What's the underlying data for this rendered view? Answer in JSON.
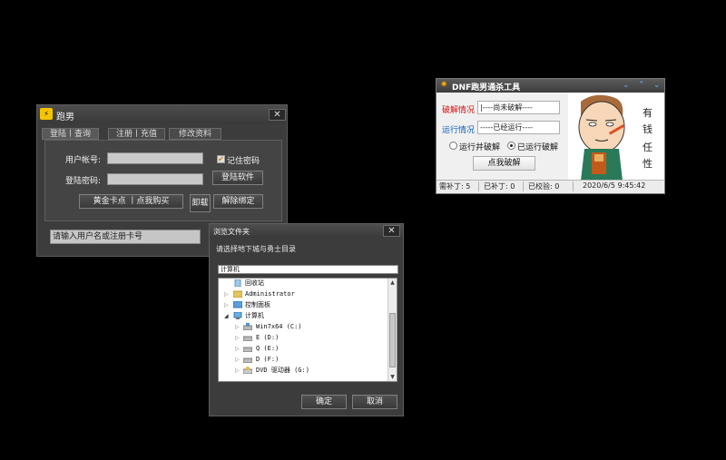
{
  "login_window": {
    "title": "跑男",
    "close": "✕",
    "tabs": [
      "登陆丨查询",
      "注册丨充值",
      "修改资料"
    ],
    "account_label": "用户帐号:",
    "password_label": "登陆密码:",
    "account_value": "",
    "password_value": "",
    "remember_label": "记住密码",
    "remember_checked": "✔",
    "login_button": "登陆软件",
    "buy_button": "黄金卡点 丨点我购买",
    "uninstall_button": "卸载",
    "unbind_button": "解除绑定",
    "status_text": "请输入用户名或注册卡号"
  },
  "tool_window": {
    "title": "DNF跑男通杀工具",
    "controls": [
      "⌄",
      "⌃",
      "⌄"
    ],
    "crack_label": "破解情况",
    "crack_value": "|----尚未破解----",
    "run_label": "运行情况",
    "run_value": "-----已经运行----",
    "radio_run_crack": "运行并破解",
    "radio_already": "已运行破解",
    "crack_button": "点我破解",
    "cartoon_text_1": "有",
    "cartoon_text_2": "钱",
    "cartoon_text_3": "任",
    "cartoon_text_4": "性",
    "status": {
      "need_patch": "需补丁: 5",
      "patched": "已补丁: 0",
      "verified": "已校验: 0",
      "datetime": "2020/6/5 9:45:42"
    },
    "colors": {
      "crack_label": "#d81010",
      "run_label": "#1060c0"
    }
  },
  "browse_dialog": {
    "title": "浏览文件夹",
    "close": "✕",
    "prompt": "请选择地下城与勇士目录",
    "path_value": "计算机",
    "tree": [
      {
        "label": "回收站",
        "icon": "recycle-bin-icon"
      },
      {
        "label": "Administrator",
        "icon": "user-folder-icon"
      },
      {
        "label": "控制面板",
        "icon": "control-panel-icon"
      },
      {
        "label": "计算机",
        "icon": "computer-icon"
      },
      {
        "label": "Win7x64 (C:)",
        "icon": "system-drive-icon"
      },
      {
        "label": "E (D:)",
        "icon": "drive-icon"
      },
      {
        "label": "Q (E:)",
        "icon": "drive-icon"
      },
      {
        "label": "D (F:)",
        "icon": "drive-icon"
      },
      {
        "label": "DVD 驱动器 (G:)",
        "icon": "dvd-drive-icon"
      }
    ],
    "ok_button": "确定",
    "cancel_button": "取消"
  }
}
